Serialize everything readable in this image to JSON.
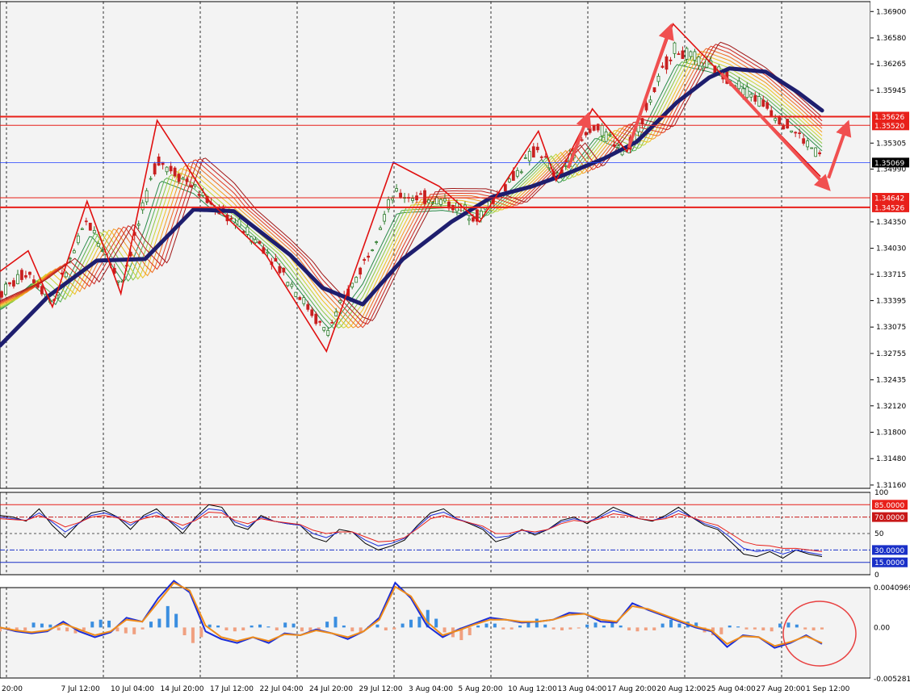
{
  "chart_data": [
    {
      "type": "candlestick",
      "instrument_note": "",
      "y_axis_ticks": [
        "1.36900",
        "1.36580",
        "1.36265",
        "1.35945",
        "1.35305",
        "1.34990",
        "1.34350",
        "1.34030",
        "1.33715",
        "1.33395",
        "1.33075",
        "1.32755",
        "1.32435",
        "1.32120",
        "1.31800",
        "1.31480",
        "1.31160"
      ],
      "ylim": [
        1.3112,
        1.3702
      ],
      "horizontal_levels": [
        {
          "value": 1.35626,
          "label": "1.35626",
          "color": "#e8201a",
          "thick": true
        },
        {
          "value": 1.3552,
          "label": "1.35520",
          "color": "#e8201a",
          "thick": false
        },
        {
          "value": 1.34642,
          "label": "1.34642",
          "color": "#e8201a",
          "thick": false
        },
        {
          "value": 1.34526,
          "label": "1.34526",
          "color": "#e8201a",
          "thick": true
        }
      ],
      "current_price": {
        "value": 1.35069,
        "label": "1.35069",
        "color": "#2040ff"
      },
      "x_axis_labels": [
        "20:00",
        "7 Jul 12:00",
        "10 Jul 04:00",
        "14 Jul 20:00",
        "17 Jul 12:00",
        "22 Jul 04:00",
        "24 Jul 20:00",
        "29 Jul 12:00",
        "3 Aug 04:00",
        "5 Aug 20:00",
        "10 Aug 12:00",
        "13 Aug 04:00",
        "17 Aug 20:00",
        "20 Aug 12:00",
        "25 Aug 04:00",
        "27 Aug 20:00",
        "1 Sep 12:00"
      ],
      "zigzag_points": [
        {
          "i": 0,
          "y": 1.3375
        },
        {
          "i": 35,
          "y": 1.34
        },
        {
          "i": 65,
          "y": 1.3332
        },
        {
          "i": 108,
          "y": 1.346
        },
        {
          "i": 150,
          "y": 1.3348
        },
        {
          "i": 195,
          "y": 1.3558
        },
        {
          "i": 260,
          "y": 1.346
        },
        {
          "i": 330,
          "y": 1.3395
        },
        {
          "i": 405,
          "y": 1.3278
        },
        {
          "i": 488,
          "y": 1.3507
        },
        {
          "i": 545,
          "y": 1.3478
        },
        {
          "i": 595,
          "y": 1.3435
        },
        {
          "i": 668,
          "y": 1.3545
        },
        {
          "i": 690,
          "y": 1.3485
        },
        {
          "i": 735,
          "y": 1.3572
        },
        {
          "i": 778,
          "y": 1.352
        },
        {
          "i": 835,
          "y": 1.3675
        },
        {
          "i": 1018,
          "y": 1.349
        }
      ],
      "ma_thick_points": [
        {
          "i": 0,
          "y": 1.3285
        },
        {
          "i": 60,
          "y": 1.3345
        },
        {
          "i": 120,
          "y": 1.3388
        },
        {
          "i": 180,
          "y": 1.339
        },
        {
          "i": 240,
          "y": 1.345
        },
        {
          "i": 290,
          "y": 1.3448
        },
        {
          "i": 360,
          "y": 1.3395
        },
        {
          "i": 400,
          "y": 1.3355
        },
        {
          "i": 450,
          "y": 1.3335
        },
        {
          "i": 500,
          "y": 1.339
        },
        {
          "i": 560,
          "y": 1.3435
        },
        {
          "i": 610,
          "y": 1.3465
        },
        {
          "i": 660,
          "y": 1.3478
        },
        {
          "i": 700,
          "y": 1.3492
        },
        {
          "i": 750,
          "y": 1.3512
        },
        {
          "i": 790,
          "y": 1.3532
        },
        {
          "i": 840,
          "y": 1.358
        },
        {
          "i": 880,
          "y": 1.361
        },
        {
          "i": 905,
          "y": 1.3621
        },
        {
          "i": 950,
          "y": 1.3617
        },
        {
          "i": 990,
          "y": 1.3592
        },
        {
          "i": 1020,
          "y": 1.357
        }
      ],
      "ribbon_colors": [
        "#2a8a4a",
        "#56b050",
        "#8cc63f",
        "#c8d435",
        "#f0c020",
        "#f39a1e",
        "#ee6a20",
        "#e03a1f",
        "#c8201c",
        "#a01818"
      ],
      "arrows": [
        {
          "from": {
            "i": 705,
            "y": 1.35
          },
          "to": {
            "i": 730,
            "y": 1.3565
          }
        },
        {
          "from": {
            "i": 780,
            "y": 1.3525
          },
          "to": {
            "i": 832,
            "y": 1.3672
          }
        },
        {
          "from": {
            "i": 895,
            "y": 1.3615
          },
          "to": {
            "i": 1028,
            "y": 1.3475
          }
        },
        {
          "from": {
            "i": 1028,
            "y": 1.3488
          },
          "to": {
            "i": 1052,
            "y": 1.3555
          }
        }
      ],
      "title": "",
      "xlabel": "",
      "ylabel": "",
      "grid": "vertical dashed"
    },
    {
      "type": "line",
      "panel": "oscillator",
      "ylim": [
        0,
        100
      ],
      "levels": [
        {
          "value": 85,
          "label": "85.0000",
          "color": "#e8201a",
          "style": "solid"
        },
        {
          "value": 70,
          "label": "70.0000",
          "color": "#c81818",
          "style": "dashdot"
        },
        {
          "value": 50,
          "label": "50",
          "color": "#555555",
          "style": "dash"
        },
        {
          "value": 30,
          "label": "30.0000",
          "color": "#1a30c8",
          "style": "dashdot"
        },
        {
          "value": 15,
          "label": "15.0000",
          "color": "#1a30c8",
          "style": "solid"
        }
      ],
      "y_axis_ticks": [
        "100",
        "50",
        "0"
      ],
      "series": [
        {
          "color": "#000000",
          "values": [
            72,
            70,
            65,
            80,
            60,
            45,
            62,
            75,
            78,
            70,
            55,
            72,
            80,
            65,
            50,
            70,
            85,
            82,
            60,
            55,
            72,
            65,
            62,
            60,
            45,
            40,
            55,
            52,
            38,
            30,
            35,
            42,
            60,
            75,
            80,
            68,
            62,
            55,
            40,
            45,
            55,
            48,
            55,
            66,
            70,
            62,
            72,
            82,
            75,
            68,
            65,
            72,
            82,
            70,
            60,
            55,
            40,
            25,
            22,
            28,
            20,
            30,
            25,
            22
          ]
        },
        {
          "color": "#1a2dd8",
          "values": [
            70,
            68,
            66,
            75,
            64,
            52,
            62,
            72,
            75,
            70,
            60,
            70,
            76,
            66,
            55,
            68,
            80,
            78,
            64,
            58,
            70,
            65,
            62,
            60,
            50,
            45,
            52,
            52,
            42,
            35,
            38,
            44,
            58,
            72,
            76,
            68,
            63,
            57,
            45,
            47,
            54,
            50,
            55,
            64,
            68,
            64,
            70,
            78,
            74,
            68,
            66,
            70,
            78,
            70,
            62,
            57,
            45,
            32,
            28,
            30,
            25,
            30,
            27,
            24
          ]
        },
        {
          "color": "#e8201a",
          "values": [
            68,
            67,
            66,
            72,
            66,
            58,
            63,
            70,
            72,
            69,
            63,
            68,
            72,
            66,
            60,
            66,
            76,
            75,
            66,
            62,
            68,
            65,
            63,
            61,
            54,
            50,
            52,
            52,
            46,
            40,
            41,
            45,
            56,
            68,
            72,
            67,
            63,
            59,
            50,
            50,
            54,
            52,
            55,
            62,
            66,
            64,
            68,
            74,
            72,
            68,
            66,
            68,
            74,
            70,
            64,
            60,
            50,
            40,
            36,
            35,
            32,
            32,
            30,
            28
          ]
        }
      ]
    },
    {
      "type": "bar",
      "panel": "histogram-with-signal",
      "ylim": [
        -0.0052,
        0.0041
      ],
      "y_axis_ticks": [
        "0.0040969",
        "0.00",
        "-0.005281"
      ],
      "histogram": [
        -0.0004,
        -0.0003,
        -0.0004,
        -0.0003,
        0.0005,
        0.0004,
        0.0003,
        -0.0003,
        -0.0004,
        -0.0006,
        -0.0003,
        0.0006,
        0.0008,
        0.0007,
        -0.0004,
        -0.0006,
        -0.0007,
        -0.0002,
        0.0006,
        0.0009,
        0.0022,
        0.0014,
        -0.0008,
        -0.0016,
        -0.001,
        0.0003,
        0.0002,
        -0.0003,
        -0.0004,
        -0.0003,
        0.0002,
        0.0003,
        0.0001,
        -0.0003,
        0.0005,
        0.0004,
        -0.0004,
        -0.0005,
        -0.0003,
        0.0006,
        0.0011,
        0.0002,
        -0.0004,
        -0.0006,
        0.0001,
        0.0003,
        -0.0003,
        -0.0002,
        0.0004,
        0.0008,
        0.0011,
        0.0018,
        0.0009,
        -0.0005,
        -0.001,
        -0.0013,
        -0.0008,
        0.0002,
        0.0004,
        0.0004,
        -0.0002,
        -0.0002,
        0.0002,
        0.0006,
        0.0009,
        0.0003,
        -0.0002,
        -0.0003,
        -0.0002,
        -0.0001,
        0.0003,
        0.0005,
        0.0002,
        0.0006,
        0.0002,
        -0.0003,
        -0.0004,
        -0.0003,
        -0.0003,
        0.0004,
        0.0008,
        0.0004,
        0.0006,
        0.0005,
        -0.0005,
        -0.0008,
        -0.0007,
        0.0002,
        0.0001,
        -0.0002,
        -0.0002,
        -0.0003,
        -0.0004,
        0.0004,
        0.0005,
        0.0003,
        -0.0002,
        -0.0003,
        -0.0002
      ],
      "signal_series": [
        {
          "color": "#1a2dd8",
          "values": [
            0,
            -0.0004,
            -0.0006,
            -0.0004,
            0.0006,
            -0.0004,
            -0.001,
            -0.0005,
            0.001,
            0.0006,
            0.003,
            0.0048,
            0.0036,
            -0.0004,
            -0.0012,
            -0.0016,
            -0.001,
            -0.0016,
            -0.0006,
            -0.0008,
            -0.0002,
            -0.0006,
            -0.0012,
            -0.0004,
            0.001,
            0.0046,
            0.003,
            0.0002,
            -0.001,
            -0.0002,
            0.0004,
            0.001,
            0.0008,
            0.0005,
            0.0006,
            0.0008,
            0.0015,
            0.0014,
            0.0006,
            0.0005,
            0.0025,
            0.0018,
            0.0012,
            0.0006,
            0.0,
            -0.0004,
            -0.002,
            -0.0008,
            -0.001,
            -0.0021,
            -0.0016,
            -0.0008,
            -0.0017
          ]
        },
        {
          "color": "#f08c1a",
          "values": [
            0,
            -0.0003,
            -0.0005,
            -0.0003,
            0.0004,
            -0.0002,
            -0.0008,
            -0.0004,
            0.0008,
            0.0006,
            0.0026,
            0.0046,
            0.0038,
            0.0002,
            -0.001,
            -0.0014,
            -0.001,
            -0.0014,
            -0.0007,
            -0.0008,
            -0.0003,
            -0.0006,
            -0.001,
            -0.0004,
            0.0008,
            0.0042,
            0.0032,
            0.0006,
            -0.0008,
            -0.0003,
            0.0003,
            0.0008,
            0.0008,
            0.0006,
            0.0006,
            0.0008,
            0.0013,
            0.0014,
            0.0008,
            0.0006,
            0.0022,
            0.0019,
            0.0013,
            0.0007,
            0.0001,
            -0.0003,
            -0.0017,
            -0.0009,
            -0.001,
            -0.0019,
            -0.0015,
            -0.0009,
            -0.0016
          ]
        }
      ],
      "annotation": {
        "shape": "ellipse",
        "color": "#e84040",
        "near": "right end"
      }
    }
  ],
  "colors": {
    "background": "#ffffff",
    "plot_bg": "#f3f3f3",
    "candle_up": "#2a7a2a",
    "candle_down": "#c82020",
    "ma_thick": "#1e1e6e",
    "zigzag": "#e01010",
    "arrow": "#f05050"
  }
}
